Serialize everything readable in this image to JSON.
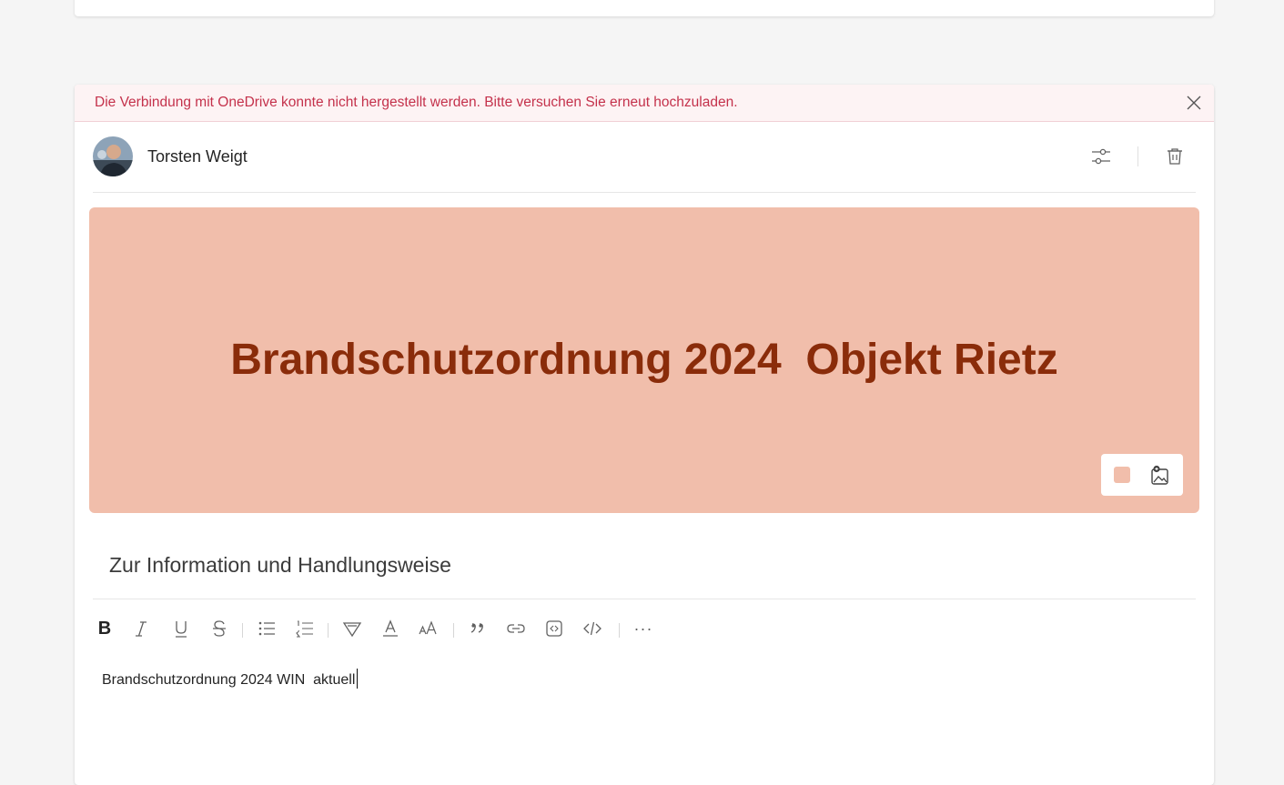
{
  "error_banner": {
    "message": "Die Verbindung mit OneDrive konnte nicht hergestellt werden. Bitte versuchen Sie erneut hochzuladen.",
    "close_icon": "close-icon",
    "color": "#c4314b"
  },
  "author": {
    "name": "Torsten Weigt",
    "actions": [
      "settings-sliders-icon",
      "trash-icon"
    ]
  },
  "banner": {
    "title": "Brandschutzordnung 2024  Objekt Rietz",
    "background_color": "#f1beab",
    "title_color": "#8a2c0a",
    "tools": [
      "color-swatch",
      "image-icon"
    ]
  },
  "subject": {
    "text": "Zur Information und Handlungsweise"
  },
  "format_toolbar": {
    "bold_label": "B",
    "more_label": "···",
    "buttons": [
      "bold-icon",
      "italic-icon",
      "underline-icon",
      "strikethrough-icon",
      "bullet-list-icon",
      "numbered-list-icon",
      "highlight-icon",
      "font-color-icon",
      "font-size-icon",
      "quote-icon",
      "link-icon",
      "embed-icon",
      "code-icon",
      "more-icon"
    ]
  },
  "body": {
    "text": "Brandschutzordnung 2024 WIN  aktuell"
  }
}
